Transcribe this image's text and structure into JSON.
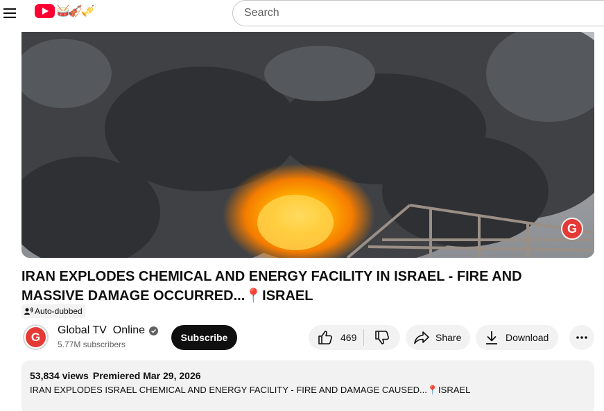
{
  "header": {
    "menu_icon": "menu-icon",
    "logo_doodle": "🥁🎻🎺",
    "search_placeholder": "Search"
  },
  "video": {
    "title": "IRAN EXPLODES CHEMICAL AND ENERGY FACILITY IN ISRAEL - FIRE AND MASSIVE DAMAGE OCCURRED...📍ISRAEL",
    "auto_dubbed_label": "Auto-dubbed",
    "watermark_letter": "G"
  },
  "channel": {
    "avatar_letter": "G",
    "name": "Global TV  Online",
    "subscribers": "5.77M subscribers",
    "subscribe_label": "Subscribe"
  },
  "actions": {
    "like_count": "469",
    "share_label": "Share",
    "download_label": "Download"
  },
  "description": {
    "views": "53,834 views",
    "premiered": "Premiered Mar 29, 2026",
    "text": "IRAN EXPLODES ISRAEL CHEMICAL AND ENERGY FACILITY - FIRE AND DAMAGE CAUSED...📍ISRAEL"
  },
  "colors": {
    "brand_red": "#ff0033",
    "subscribe_bg": "#0f0f0f",
    "pill_bg": "#f2f2f2"
  }
}
